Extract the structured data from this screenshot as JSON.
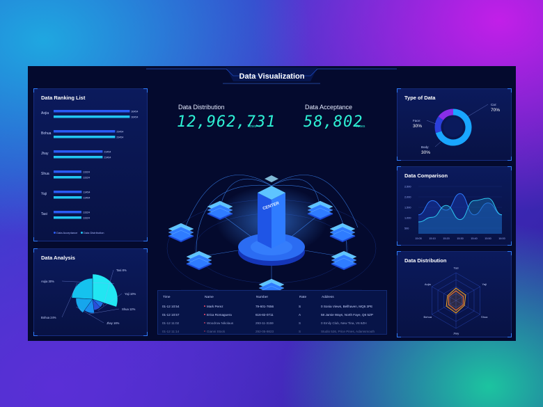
{
  "header": {
    "title": "Data Visualization"
  },
  "ranking": {
    "title": "Data Ranking List",
    "legend_acceptance": "Data Acceptance",
    "legend_distribution": "Data Distribution",
    "items": [
      {
        "name": "Aojia",
        "v1": 36454,
        "v2": 36454,
        "l1": "36454",
        "l2": "36454"
      },
      {
        "name": "Bohua",
        "v1": 29454,
        "v2": 29454,
        "l1": "29454",
        "l2": "29454"
      },
      {
        "name": "Jhay",
        "v1": 23454,
        "v2": 23464,
        "l1": "23454",
        "l2": "23464"
      },
      {
        "name": "Shua",
        "v1": 13324,
        "v2": 13324,
        "l1": "13324",
        "l2": "13324"
      },
      {
        "name": "Yaji",
        "v1": 13454,
        "v2": 13464,
        "l1": "13454",
        "l2": "13464"
      },
      {
        "name": "Tasi",
        "v1": 13324,
        "v2": 13324,
        "l1": "13324",
        "l2": "13324"
      }
    ]
  },
  "analysis": {
    "title": "Data Analysis",
    "slices": [
      {
        "label": "Aojia 30%",
        "value": 30,
        "color": "#22e6f2"
      },
      {
        "label": "Tasi 8%",
        "value": 8,
        "color": "#1f6fe8"
      },
      {
        "label": "Yaji 10%",
        "value": 10,
        "color": "#2a4fd8"
      },
      {
        "label": "Shua 12%",
        "value": 12,
        "color": "#1a8ef0"
      },
      {
        "label": "Jhay 16%",
        "value": 16,
        "color": "#16a6ec"
      },
      {
        "label": "Bohua 24%",
        "value": 24,
        "color": "#15c2ee"
      }
    ]
  },
  "center": {
    "dist_label": "Data Distribution",
    "dist_value": "12,962,731",
    "dist_unit": "Times",
    "acc_label": "Data Acceptance",
    "acc_value": "58,802",
    "acc_unit": "Times",
    "tower_label": "CENTER"
  },
  "table": {
    "headers": [
      "Time",
      "Name",
      "Number",
      "Rate",
      "Address"
    ],
    "rows": [
      [
        "01-12 10:54",
        "Mark Perez",
        "79-601-7656",
        "S",
        "0 Sonia Views, Bellhaven, MQ5 3PE"
      ],
      [
        "01-12 10:57",
        "Erica Romaguera",
        "616-82-0711",
        "A",
        "58 Jamie Ways, North Faye, Q6 5ZP"
      ],
      [
        "01-12 11:02",
        "Woodrow Nikolaus",
        "293-11-3159",
        "S",
        "0 Emily Club, New Tina, V6 6ZH"
      ],
      [
        "01-12 11:14",
        "Gianni Stock",
        "292-05-9823",
        "S",
        "Studio 526, Price Pines, Adamsmouth"
      ]
    ]
  },
  "type_of_data": {
    "title": "Type of Data",
    "segments": [
      {
        "label": "Car",
        "pct": "70%",
        "value": 70,
        "color": "#19a6ff"
      },
      {
        "label": "Face",
        "pct": "30%",
        "value": 15,
        "color": "#2b3fd9"
      },
      {
        "label": "Body",
        "pct": "30%",
        "value": 15,
        "color": "#8a2ee8"
      }
    ]
  },
  "comparison": {
    "title": "Data Comparison",
    "yticks": [
      "2,500",
      "2,000",
      "1,500",
      "1,000",
      "500"
    ],
    "xticks": [
      "15:05",
      "15:10",
      "15:20",
      "15:30",
      "15:40",
      "15:50",
      "16:00"
    ]
  },
  "distribution_radar": {
    "title": "Data Distribution",
    "axes": [
      "Tasi",
      "Yaji",
      "Shua",
      "Jhay",
      "Bohua",
      "Aojia"
    ]
  },
  "chart_data": [
    {
      "type": "bar",
      "title": "Data Ranking List",
      "categories": [
        "Aojia",
        "Bohua",
        "Jhay",
        "Shua",
        "Yaji",
        "Tasi"
      ],
      "series": [
        {
          "name": "Data Acceptance",
          "values": [
            36454,
            29454,
            23454,
            13324,
            13454,
            13324
          ]
        },
        {
          "name": "Data Distribution",
          "values": [
            36454,
            29454,
            23464,
            13324,
            13464,
            13324
          ]
        }
      ]
    },
    {
      "type": "pie",
      "title": "Data Analysis",
      "categories": [
        "Aojia",
        "Tasi",
        "Yaji",
        "Shua",
        "Jhay",
        "Bohua"
      ],
      "values": [
        30,
        8,
        10,
        12,
        16,
        24
      ]
    },
    {
      "type": "pie",
      "title": "Type of Data",
      "categories": [
        "Car",
        "Face",
        "Body"
      ],
      "values": [
        70,
        30,
        30
      ]
    },
    {
      "type": "area",
      "title": "Data Comparison",
      "x": [
        "15:05",
        "15:10",
        "15:20",
        "15:30",
        "15:40",
        "15:50",
        "16:00"
      ],
      "ylim": [
        500,
        2500
      ],
      "series": [
        {
          "values": [
            1300,
            1900,
            1500,
            2200,
            1300,
            1800,
            1300
          ]
        },
        {
          "values": [
            1000,
            1200,
            1700,
            1100,
            1900,
            2000,
            1300
          ]
        }
      ]
    },
    {
      "type": "radar",
      "title": "Data Distribution",
      "categories": [
        "Tasi",
        "Yaji",
        "Shua",
        "Jhay",
        "Bohua",
        "Aojia"
      ],
      "series": [
        {
          "values": [
            0.45,
            0.4,
            0.35,
            0.45,
            0.4,
            0.35
          ]
        },
        {
          "values": [
            0.35,
            0.3,
            0.3,
            0.35,
            0.3,
            0.3
          ]
        }
      ]
    }
  ]
}
